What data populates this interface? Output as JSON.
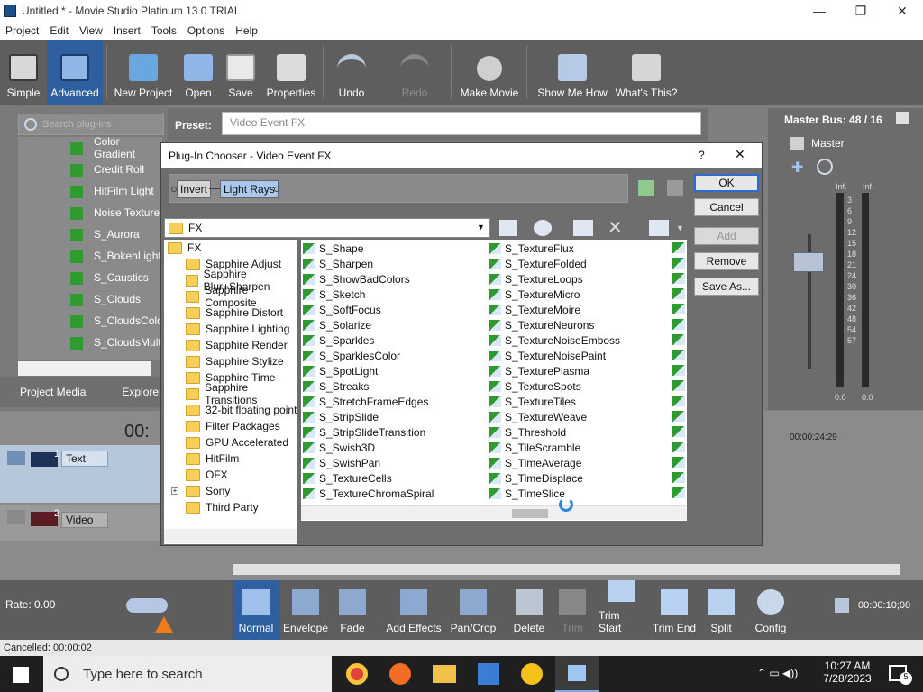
{
  "window": {
    "title": "Untitled * - Movie Studio Platinum 13.0 TRIAL"
  },
  "menu": [
    "Project",
    "Edit",
    "View",
    "Insert",
    "Tools",
    "Options",
    "Help"
  ],
  "toolbar": {
    "buttons": [
      "Simple",
      "Advanced",
      "New Project",
      "Open",
      "Save",
      "Properties",
      "Undo",
      "Redo",
      "Make Movie",
      "Show Me How",
      "What's This?"
    ]
  },
  "left_panel": {
    "search_placeholder": "Search plug-ins",
    "plugins": [
      "Color Gradient",
      "Credit Roll",
      "HitFilm Light",
      "Noise Texture",
      "S_Aurora",
      "S_BokehLight",
      "S_Caustics",
      "S_Clouds",
      "S_CloudsColor",
      "S_CloudsMulti"
    ],
    "tabs": [
      "Project Media",
      "Explorer"
    ]
  },
  "preset": {
    "label": "Preset:",
    "value": "Video Event FX"
  },
  "master": {
    "title": "Master Bus: 48 / 16",
    "label": "Master",
    "inf_left": "-Inf.",
    "inf_right": "-Inf.",
    "scale": [
      "3",
      "6",
      "9",
      "12",
      "15",
      "18",
      "21",
      "24",
      "30",
      "36",
      "42",
      "48",
      "54",
      "57"
    ],
    "bottom_left": "0.0",
    "bottom_right": "0.0"
  },
  "dialog": {
    "title": "Plug-In Chooser - Video Event FX",
    "help": "?",
    "close": "✕",
    "chain": [
      "Invert",
      "Light Rays"
    ],
    "location": "FX",
    "tree": [
      "FX",
      "Sapphire Adjust",
      "Sapphire Blur+Sharpen",
      "Sapphire Composite",
      "Sapphire Distort",
      "Sapphire Lighting",
      "Sapphire Render",
      "Sapphire Stylize",
      "Sapphire Time",
      "Sapphire Transitions",
      "32-bit floating point",
      "Filter Packages",
      "GPU Accelerated",
      "HitFilm",
      "OFX",
      "Sony",
      "Third Party"
    ],
    "col1": [
      "S_Shape",
      "S_Sharpen",
      "S_ShowBadColors",
      "S_Sketch",
      "S_SoftFocus",
      "S_Solarize",
      "S_Sparkles",
      "S_SparklesColor",
      "S_SpotLight",
      "S_Streaks",
      "S_StretchFrameEdges",
      "S_StripSlide",
      "S_StripSlideTransition",
      "S_Swish3D",
      "S_SwishPan",
      "S_TextureCells",
      "S_TextureChromaSpiral"
    ],
    "col2": [
      "S_TextureFlux",
      "S_TextureFolded",
      "S_TextureLoops",
      "S_TextureMicro",
      "S_TextureMoire",
      "S_TextureNeurons",
      "S_TextureNoiseEmboss",
      "S_TextureNoisePaint",
      "S_TexturePlasma",
      "S_TextureSpots",
      "S_TextureTiles",
      "S_TextureWeave",
      "S_Threshold",
      "S_TileScramble",
      "S_TimeAverage",
      "S_TimeDisplace",
      "S_TimeSlice"
    ],
    "buttons": {
      "ok": "OK",
      "cancel": "Cancel",
      "add": "Add",
      "remove": "Remove",
      "save_as": "Save As..."
    }
  },
  "timeline": {
    "time": "00:",
    "ruler_time": "00:00:24:29",
    "tracks": [
      {
        "num": "1",
        "name": "Text"
      },
      {
        "num": "2",
        "name": "Video"
      }
    ]
  },
  "bottom": {
    "rate": "Rate: 0.00",
    "tools": [
      "Normal",
      "Envelope",
      "Fade",
      "Add Effects",
      "Pan/Crop",
      "Delete",
      "Trim",
      "Trim Start",
      "Trim End",
      "Split",
      "Config"
    ],
    "timecode": "00:00:10;00"
  },
  "status": "Cancelled: 00:00:02",
  "taskbar": {
    "search_placeholder": "Type here to search",
    "time": "10:27 AM",
    "date": "7/28/2023",
    "notif": "5"
  },
  "colors": {
    "accent": "#2c6bd4",
    "folder": "#f6cf58",
    "chip_selected": "#a9c8ec",
    "fx_green": "#2f9a2f"
  }
}
